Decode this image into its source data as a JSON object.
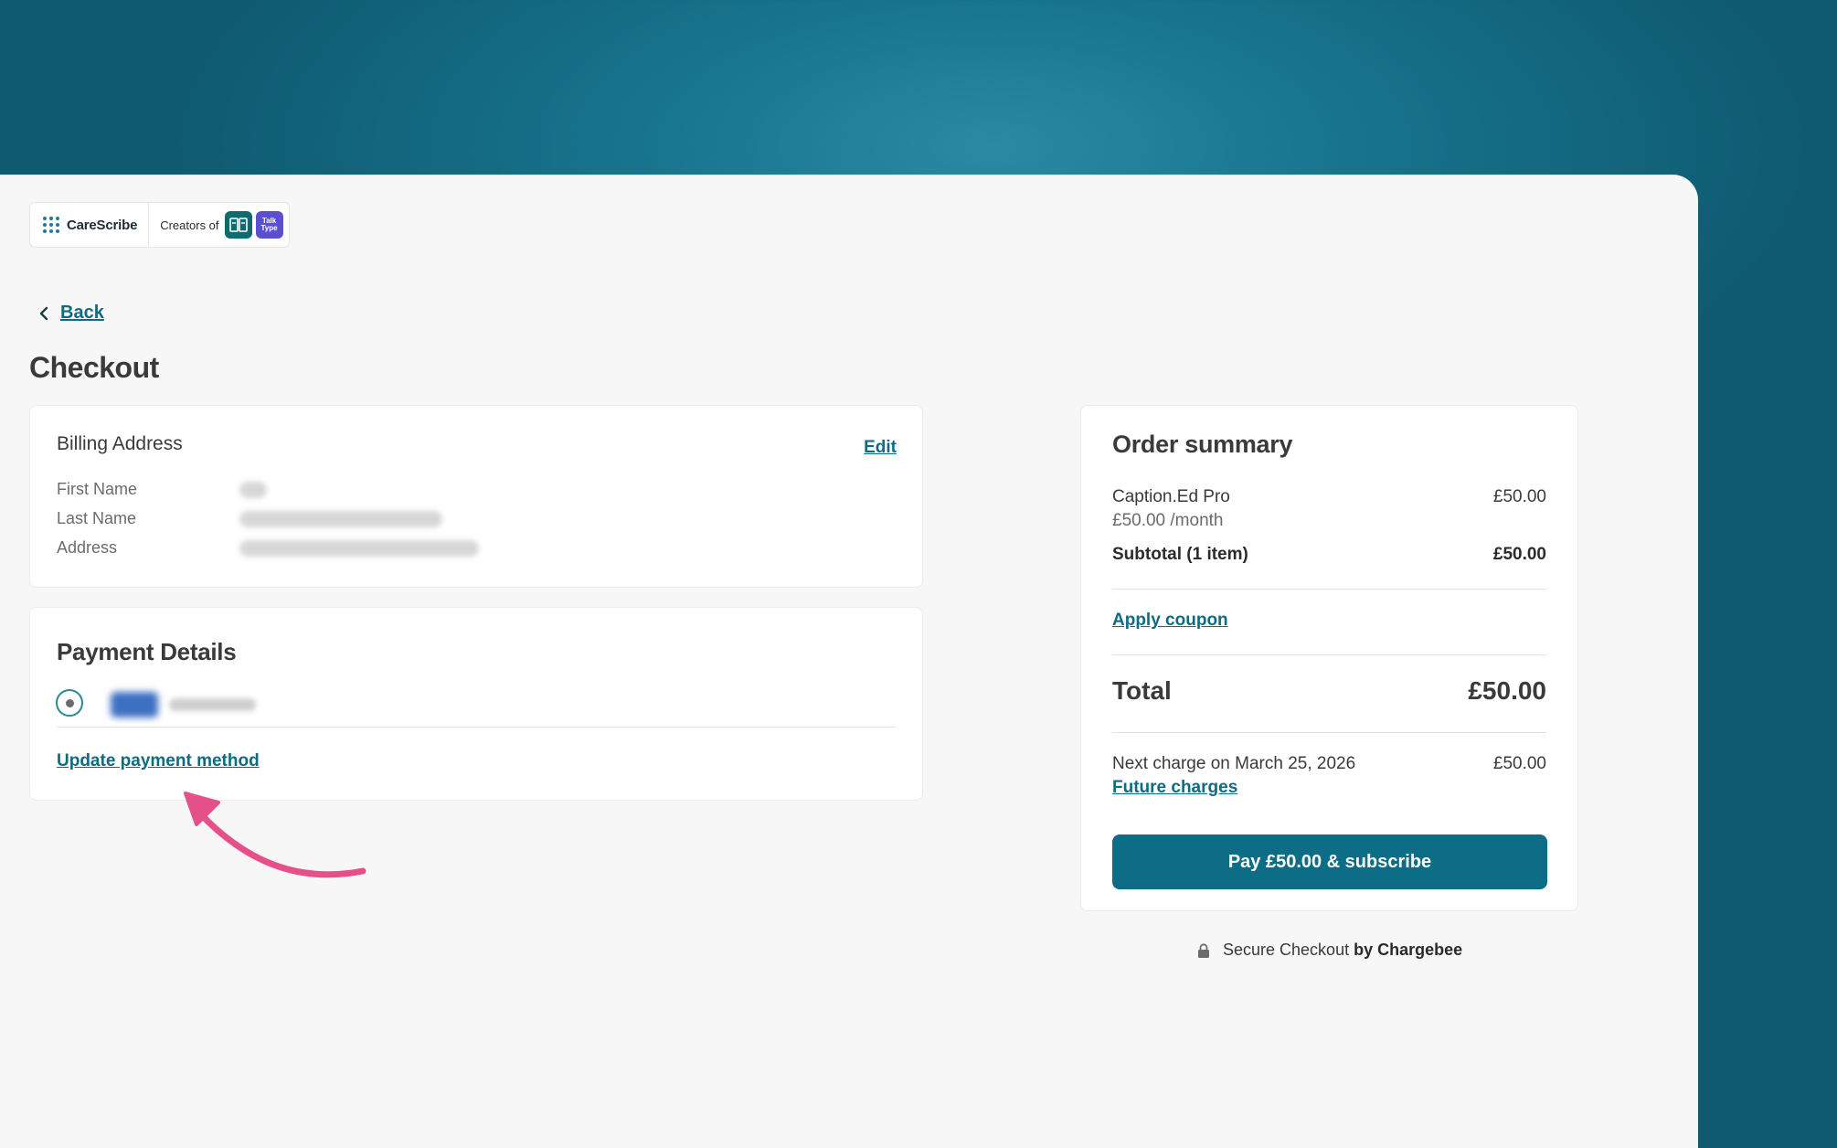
{
  "header": {
    "brand": "CareScribe",
    "creators_label": "Creators of",
    "app2_line1": "Talk",
    "app2_line2": "Type"
  },
  "nav": {
    "back_label": "Back"
  },
  "page": {
    "title": "Checkout"
  },
  "billing": {
    "title": "Billing Address",
    "edit_label": "Edit",
    "fields": [
      {
        "label": "First Name"
      },
      {
        "label": "Last Name"
      },
      {
        "label": "Address"
      }
    ]
  },
  "payment": {
    "title": "Payment Details",
    "update_label": "Update payment method"
  },
  "summary": {
    "title": "Order summary",
    "item_name": "Caption.Ed Pro",
    "item_price": "£50.00",
    "item_period": "£50.00 /month",
    "subtotal_label": "Subtotal (1 item)",
    "subtotal_value": "£50.00",
    "coupon_label": "Apply coupon",
    "total_label": "Total",
    "total_value": "£50.00",
    "next_charge_label": "Next charge on March 25, 2026",
    "next_charge_value": "£50.00",
    "future_charges_label": "Future charges",
    "pay_button": "Pay £50.00 & subscribe"
  },
  "footer": {
    "secure_label": "Secure Checkout",
    "by_label": "by Chargebee"
  },
  "colors": {
    "accent": "#0d6d87",
    "link": "#0f6b82",
    "annotation_arrow": "#e6508a"
  }
}
